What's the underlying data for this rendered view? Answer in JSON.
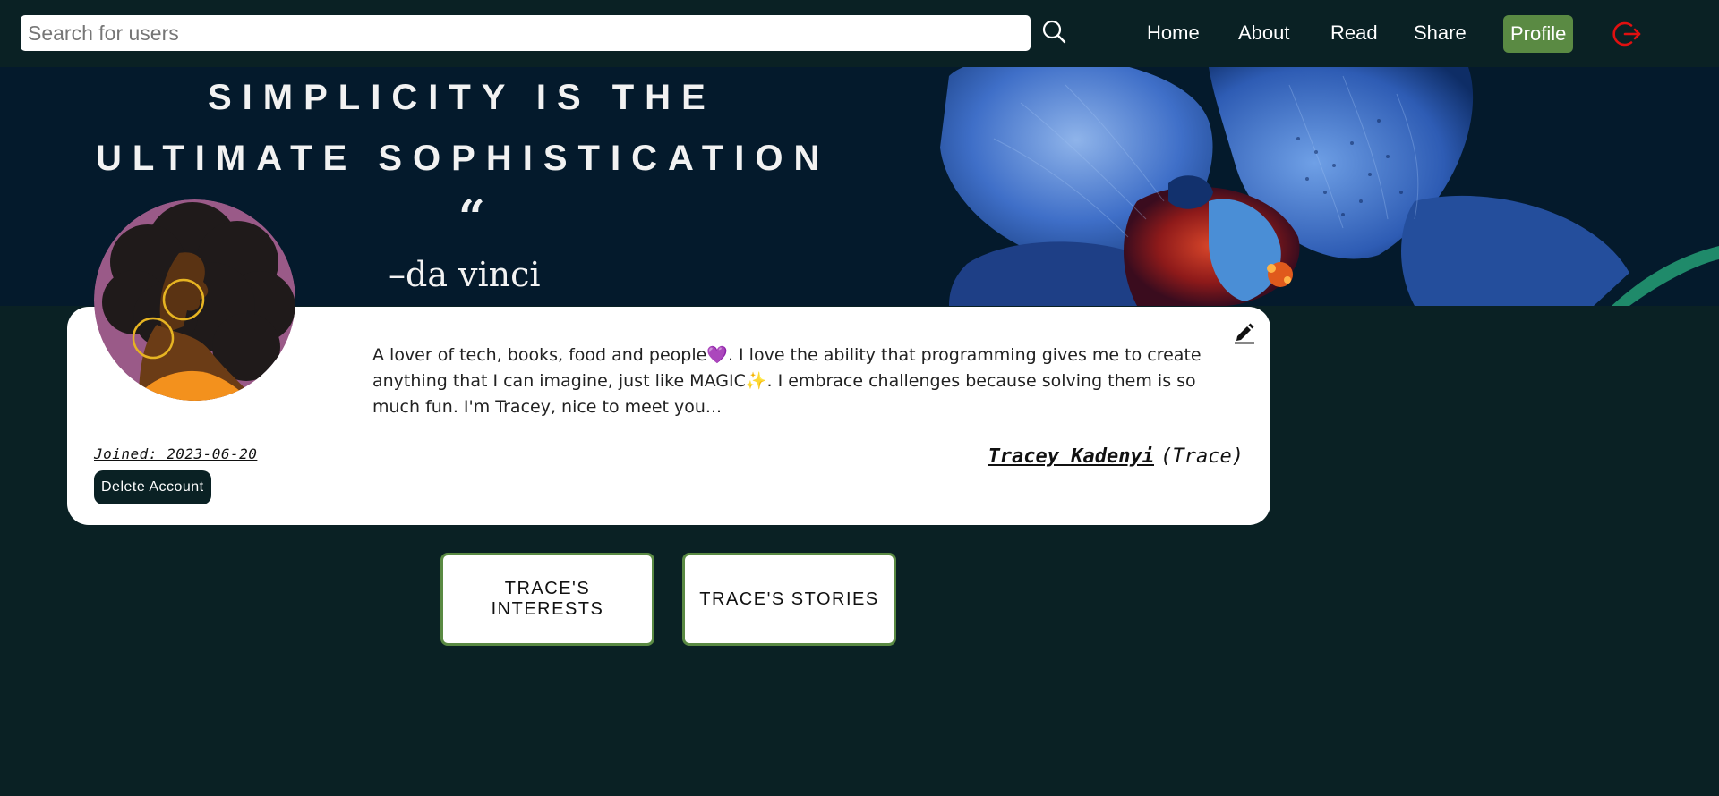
{
  "search": {
    "placeholder": "Search for users"
  },
  "nav": {
    "home": "Home",
    "about": "About",
    "read": "Read",
    "share": "Share",
    "profile": "Profile"
  },
  "banner": {
    "quote_line_1": "SIMPLICITY IS THE",
    "quote_line_2": "ULTIMATE SOPHISTICATION",
    "quote_mark": "“",
    "author": "–da vinci"
  },
  "profile": {
    "bio": "A lover of tech, books, food and people💜. I love the ability that programming gives me to create anything that I can imagine, just like MAGIC✨. I embrace challenges because solving them is so much fun. I'm Tracey, nice to meet you...",
    "joined": "Joined: 2023-06-20",
    "delete_label": "Delete Account",
    "full_name": "Tracey Kadenyi",
    "nickname": "(Trace)"
  },
  "tabs": {
    "interests": "TRACE'S INTERESTS",
    "stories": "TRACE'S STORIES"
  },
  "colors": {
    "page_bg": "#0a2124",
    "accent": "#5a8a43",
    "logout": "#e01010"
  }
}
